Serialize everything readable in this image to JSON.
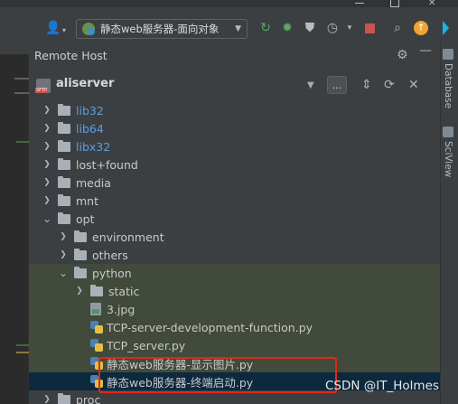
{
  "toolbar": {
    "run_config": "静态web服务器-面向对象"
  },
  "panel": {
    "title": "Remote Host",
    "host": "aliserver",
    "ellipsis": "..."
  },
  "sidebar": {
    "database": "Database",
    "sciview": "SciView"
  },
  "tree": [
    {
      "label": "lib32",
      "depth": 0,
      "kind": "folder",
      "expand": "right",
      "style": "blue"
    },
    {
      "label": "lib64",
      "depth": 0,
      "kind": "folder",
      "expand": "right",
      "style": "blue"
    },
    {
      "label": "libx32",
      "depth": 0,
      "kind": "folder",
      "expand": "right",
      "style": "blue"
    },
    {
      "label": "lost+found",
      "depth": 0,
      "kind": "folder",
      "expand": "right",
      "style": "norm"
    },
    {
      "label": "media",
      "depth": 0,
      "kind": "folder",
      "expand": "right",
      "style": "norm"
    },
    {
      "label": "mnt",
      "depth": 0,
      "kind": "folder",
      "expand": "right",
      "style": "norm"
    },
    {
      "label": "opt",
      "depth": 0,
      "kind": "folder",
      "expand": "down",
      "style": "norm"
    },
    {
      "label": "environment",
      "depth": 1,
      "kind": "folder",
      "expand": "right",
      "style": "norm"
    },
    {
      "label": "others",
      "depth": 1,
      "kind": "folder",
      "expand": "right",
      "style": "norm"
    },
    {
      "label": "python",
      "depth": 1,
      "kind": "folder",
      "expand": "down",
      "style": "norm",
      "hl": true
    },
    {
      "label": "static",
      "depth": 2,
      "kind": "folder",
      "expand": "right",
      "style": "norm",
      "hl": true
    },
    {
      "label": "3.jpg",
      "depth": 2,
      "kind": "image",
      "expand": "",
      "style": "norm",
      "hl": true
    },
    {
      "label": "TCP-server-development-function.py",
      "depth": 2,
      "kind": "py",
      "expand": "",
      "style": "norm",
      "hl": true
    },
    {
      "label": "TCP_server.py",
      "depth": 2,
      "kind": "py",
      "expand": "",
      "style": "norm",
      "hl": true
    },
    {
      "label": "静态web服务器-显示图片.py",
      "depth": 2,
      "kind": "py",
      "expand": "",
      "style": "norm",
      "hl": true
    },
    {
      "label": "静态web服务器-终端启动.py",
      "depth": 2,
      "kind": "py",
      "expand": "",
      "style": "norm",
      "sel": true
    },
    {
      "label": "proc",
      "depth": 0,
      "kind": "folder",
      "expand": "right",
      "style": "norm"
    }
  ],
  "watermark": "CSDN @IT_Holmes",
  "colors": {
    "accent_red": "#e0281e",
    "selection": "#0d293e",
    "highlight": "#414a3b"
  }
}
